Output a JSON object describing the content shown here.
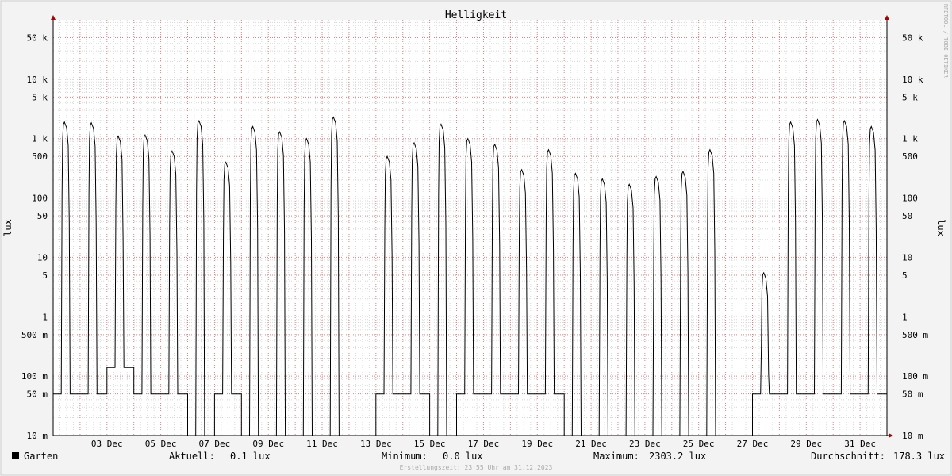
{
  "chart_data": {
    "type": "line",
    "title": "Helligkeit",
    "ylabel": "lux",
    "y_scale": "log",
    "ylim": [
      0.01,
      100000
    ],
    "y_ticks": [
      {
        "value": 0.01,
        "label": "10 m"
      },
      {
        "value": 0.05,
        "label": "50 m"
      },
      {
        "value": 0.1,
        "label": "100 m"
      },
      {
        "value": 0.5,
        "label": "500 m"
      },
      {
        "value": 1,
        "label": "1"
      },
      {
        "value": 5,
        "label": "5"
      },
      {
        "value": 10,
        "label": "10"
      },
      {
        "value": 50,
        "label": "50"
      },
      {
        "value": 100,
        "label": "100"
      },
      {
        "value": 500,
        "label": "500"
      },
      {
        "value": 1000,
        "label": "1 k"
      },
      {
        "value": 5000,
        "label": "5 k"
      },
      {
        "value": 10000,
        "label": "10 k"
      },
      {
        "value": 50000,
        "label": "50 k"
      }
    ],
    "x_ticks": [
      "03 Dec",
      "05 Dec",
      "07 Dec",
      "09 Dec",
      "11 Dec",
      "13 Dec",
      "15 Dec",
      "17 Dec",
      "19 Dec",
      "21 Dec",
      "23 Dec",
      "25 Dec",
      "27 Dec",
      "29 Dec",
      "31 Dec"
    ],
    "grid": true,
    "series": [
      {
        "name": "Garten",
        "color": "#000000",
        "daily_peaks": [
          {
            "date": "01 Dec",
            "peak": 1900,
            "night": 0.05
          },
          {
            "date": "02 Dec",
            "peak": 1850,
            "night": 0.05
          },
          {
            "date": "03 Dec",
            "peak": 1100,
            "night": 0.14
          },
          {
            "date": "04 Dec",
            "peak": 1150,
            "night": 0.05
          },
          {
            "date": "05 Dec",
            "peak": 620,
            "night": 0.05
          },
          {
            "date": "06 Dec",
            "peak": 2000,
            "night": 0.01
          },
          {
            "date": "07 Dec",
            "peak": 400,
            "night": 0.05
          },
          {
            "date": "08 Dec",
            "peak": 1600,
            "night": 0.01
          },
          {
            "date": "09 Dec",
            "peak": 1300,
            "night": 0.01
          },
          {
            "date": "10 Dec",
            "peak": 1000,
            "night": 0.01
          },
          {
            "date": "11 Dec",
            "peak": 2300,
            "night": 0.01
          },
          {
            "date": "12 Dec",
            "peak": 0.01,
            "night": 0.01
          },
          {
            "date": "13 Dec",
            "peak": 500,
            "night": 0.05
          },
          {
            "date": "14 Dec",
            "peak": 850,
            "night": 0.05
          },
          {
            "date": "15 Dec",
            "peak": 1750,
            "night": 0.01
          },
          {
            "date": "16 Dec",
            "peak": 1000,
            "night": 0.05
          },
          {
            "date": "17 Dec",
            "peak": 800,
            "night": 0.05
          },
          {
            "date": "18 Dec",
            "peak": 300,
            "night": 0.05
          },
          {
            "date": "19 Dec",
            "peak": 650,
            "night": 0.05
          },
          {
            "date": "20 Dec",
            "peak": 260,
            "night": 0.01
          },
          {
            "date": "21 Dec",
            "peak": 210,
            "night": 0.01
          },
          {
            "date": "22 Dec",
            "peak": 170,
            "night": 0.01
          },
          {
            "date": "23 Dec",
            "peak": 230,
            "night": 0.01
          },
          {
            "date": "24 Dec",
            "peak": 280,
            "night": 0.01
          },
          {
            "date": "25 Dec",
            "peak": 650,
            "night": 0.01
          },
          {
            "date": "26 Dec",
            "peak": 0.01,
            "night": 0.01
          },
          {
            "date": "27 Dec",
            "peak": 5.5,
            "night": 0.05
          },
          {
            "date": "28 Dec",
            "peak": 1900,
            "night": 0.05
          },
          {
            "date": "29 Dec",
            "peak": 2100,
            "night": 0.05
          },
          {
            "date": "30 Dec",
            "peak": 2000,
            "night": 0.05
          },
          {
            "date": "31 Dec",
            "peak": 1600,
            "night": 0.05
          }
        ]
      }
    ],
    "colors": {
      "grid_major": "#e08080",
      "grid_minor": "#d8d8d8",
      "line": "#000000",
      "frame": "#b0b0b0",
      "arrow": "#aa0000"
    }
  },
  "legend": {
    "series_name": "Garten",
    "current_label": "Aktuell:",
    "current_value": "0.1 lux",
    "minimum_label": "Minimum:",
    "minimum_value": "0.0 lux",
    "maximum_label": "Maximum:",
    "maximum_value": "2303.2 lux",
    "average_label": "Durchschnitt:",
    "average_value": "178.3 lux"
  },
  "footer": "Erstellungszeit: 23:55 Uhr am 31.12.2023",
  "watermark": "RRDTOOL / TOBI OETIKER"
}
